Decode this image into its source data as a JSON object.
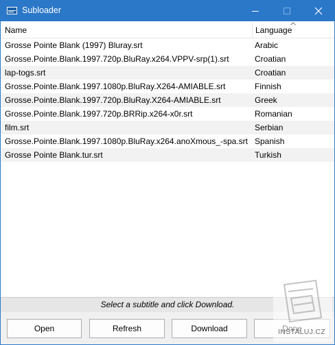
{
  "window": {
    "title": "Subloader"
  },
  "columns": {
    "name": "Name",
    "language": "Language"
  },
  "rows": [
    {
      "name": "Grosse Pointe Blank (1997) Bluray.srt",
      "language": "Arabic"
    },
    {
      "name": "Grosse.Pointe.Blank.1997.720p.BluRay.x264.VPPV-srp(1).srt",
      "language": "Croatian"
    },
    {
      "name": "lap-togs.srt",
      "language": "Croatian"
    },
    {
      "name": "Grosse.Pointe.Blank.1997.1080p.BluRay.X264-AMIABLE.srt",
      "language": "Finnish"
    },
    {
      "name": "Grosse.Pointe.Blank.1997.720p.BluRay.X264-AMIABLE.srt",
      "language": "Greek"
    },
    {
      "name": "Grosse.Pointe.Blank.1997.720p.BRRip.x264-x0r.srt",
      "language": "Romanian"
    },
    {
      "name": "film.srt",
      "language": "Serbian"
    },
    {
      "name": "Grosse.Pointe.Blank.1997.1080p.BluRay.x264.anoXmous_-spa.srt",
      "language": "Spanish"
    },
    {
      "name": "Grosse Pointe Blank.tur.srt",
      "language": "Turkish"
    }
  ],
  "status": {
    "text": "Select a subtitle and click Download."
  },
  "buttons": {
    "open": "Open",
    "refresh": "Refresh",
    "download": "Download",
    "done": "Done"
  },
  "watermark": {
    "text": "INSTALUJ.CZ"
  },
  "colors": {
    "titlebar": "#2b78c9",
    "row_alt": "#f2f2f2",
    "statusbar": "#e6e6e6"
  }
}
